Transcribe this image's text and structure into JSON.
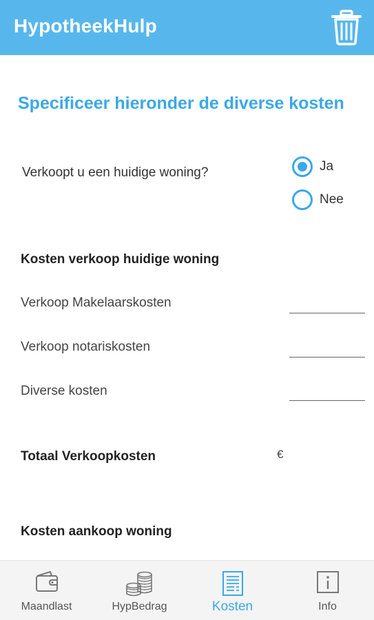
{
  "app": {
    "title": "HypotheekHulp"
  },
  "page": {
    "heading": "Specificeer hieronder de diverse kosten"
  },
  "question": {
    "label": "Verkoopt u een huidige woning?",
    "options": [
      {
        "label": "Ja",
        "checked": true
      },
      {
        "label": "Nee",
        "checked": false
      }
    ]
  },
  "sale_section": {
    "title": "Kosten verkoop huidige woning",
    "fields": [
      {
        "label": "Verkoop Makelaarskosten",
        "value": ""
      },
      {
        "label": "Verkoop notariskosten",
        "value": ""
      },
      {
        "label": "Diverse kosten",
        "value": ""
      }
    ],
    "total": {
      "label": "Totaal Verkoopkosten",
      "currency": "€",
      "value": ""
    }
  },
  "purchase_section": {
    "title": "Kosten aankoop woning"
  },
  "bottom_nav": {
    "items": [
      {
        "label": "Maandlast",
        "icon": "wallet-icon",
        "active": false
      },
      {
        "label": "HypBedrag",
        "icon": "coins-icon",
        "active": false
      },
      {
        "label": "Kosten",
        "icon": "receipt-icon",
        "active": true
      },
      {
        "label": "Info",
        "icon": "info-icon",
        "active": false
      }
    ]
  },
  "colors": {
    "primary": "#57b7ec",
    "accent": "#3aa8e8",
    "nav_background": "#f4f4f4"
  }
}
